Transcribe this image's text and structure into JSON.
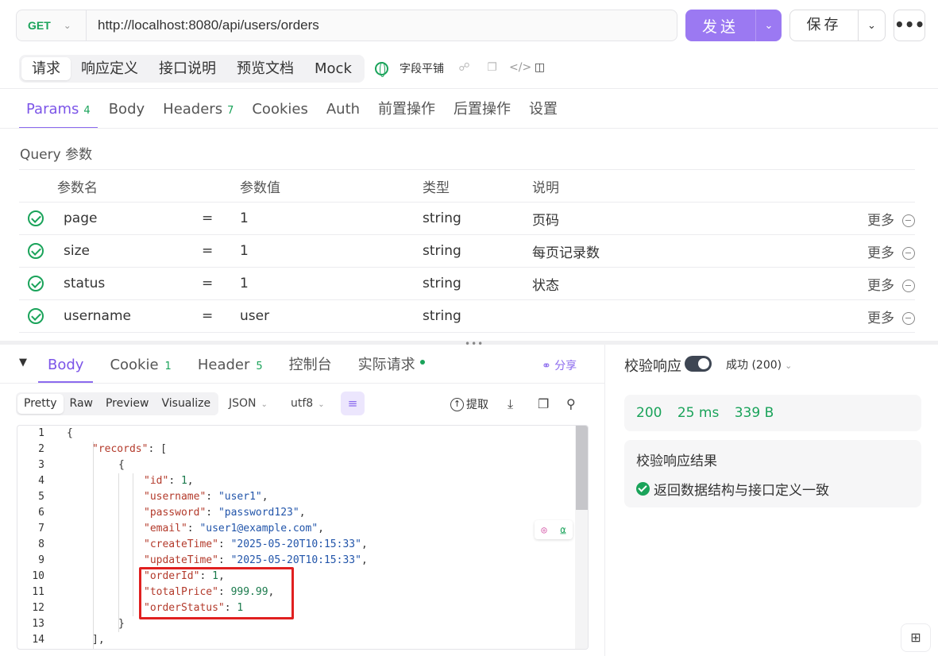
{
  "request": {
    "method": "GET",
    "url": "http://localhost:8080/api/users/orders",
    "send_label": "发送",
    "save_label": "保存",
    "more_label": "•••"
  },
  "mode_tabs": [
    {
      "label": "请求",
      "active": true
    },
    {
      "label": "响应定义"
    },
    {
      "label": "接口说明"
    },
    {
      "label": "预览文档"
    },
    {
      "label": "Mock"
    }
  ],
  "flatten_label": "字段平铺",
  "param_tabs": [
    {
      "label": "Params",
      "count": "4",
      "active": true
    },
    {
      "label": "Body"
    },
    {
      "label": "Headers",
      "count": "7"
    },
    {
      "label": "Cookies"
    },
    {
      "label": "Auth"
    },
    {
      "label": "前置操作"
    },
    {
      "label": "后置操作"
    },
    {
      "label": "设置"
    }
  ],
  "query": {
    "title": "Query 参数",
    "columns": [
      "参数名",
      "参数值",
      "类型",
      "说明"
    ],
    "rows": [
      {
        "name": "page",
        "eq": "=",
        "value": "1",
        "type": "string",
        "desc": "页码",
        "more": "更多"
      },
      {
        "name": "size",
        "eq": "=",
        "value": "1",
        "type": "string",
        "desc": "每页记录数",
        "more": "更多"
      },
      {
        "name": "status",
        "eq": "=",
        "value": "1",
        "type": "string",
        "desc": "状态",
        "more": "更多"
      },
      {
        "name": "username",
        "eq": "=",
        "value": "user",
        "type": "string",
        "desc": "",
        "more": "更多"
      }
    ]
  },
  "response_tabs": [
    {
      "label": "Body",
      "active": true
    },
    {
      "label": "Cookie",
      "count": "1"
    },
    {
      "label": "Header",
      "count": "5"
    },
    {
      "label": "控制台"
    },
    {
      "label": "实际请求"
    }
  ],
  "share_label": "分享",
  "format_tabs": [
    {
      "label": "Pretty",
      "active": true
    },
    {
      "label": "Raw"
    },
    {
      "label": "Preview"
    },
    {
      "label": "Visualize"
    }
  ],
  "format_select": "JSON",
  "encoding_select": "utf8",
  "extract_label": "提取",
  "code_lines": [
    {
      "n": "1",
      "text": "{"
    },
    {
      "n": "2",
      "key": "\"records\"",
      "rest": ": ["
    },
    {
      "n": "3",
      "text": "{"
    },
    {
      "n": "4",
      "key": "\"id\"",
      "rest": ": ",
      "num": "1",
      "tail": ","
    },
    {
      "n": "5",
      "key": "\"username\"",
      "rest": ": ",
      "str": "\"user1\"",
      "tail": ","
    },
    {
      "n": "6",
      "key": "\"password\"",
      "rest": ": ",
      "str": "\"password123\"",
      "tail": ","
    },
    {
      "n": "7",
      "key": "\"email\"",
      "rest": ": ",
      "str": "\"user1@example.com\"",
      "tail": ","
    },
    {
      "n": "8",
      "key": "\"createTime\"",
      "rest": ": ",
      "str": "\"2025-05-20T10:15:33\"",
      "tail": ","
    },
    {
      "n": "9",
      "key": "\"updateTime\"",
      "rest": ": ",
      "str": "\"2025-05-20T10:15:33\"",
      "tail": ","
    },
    {
      "n": "10",
      "key": "\"orderId\"",
      "rest": ": ",
      "num": "1",
      "tail": ","
    },
    {
      "n": "11",
      "key": "\"totalPrice\"",
      "rest": ": ",
      "num": "999.99",
      "tail": ","
    },
    {
      "n": "12",
      "key": "\"orderStatus\"",
      "rest": ": ",
      "num": "1",
      "tail": ""
    },
    {
      "n": "13",
      "text": "}"
    },
    {
      "n": "14",
      "text": "],"
    }
  ],
  "validation": {
    "title": "校验响应",
    "toggle_on": true,
    "status_select": "成功 (200)",
    "status_code": "200",
    "time": "25 ms",
    "size": "339 B",
    "result_title": "校验响应结果",
    "result_text": "返回数据结构与接口定义一致"
  },
  "colors": {
    "accent": "#8b6aee",
    "success": "#1aa35a",
    "highlight_box": "#e02020"
  }
}
